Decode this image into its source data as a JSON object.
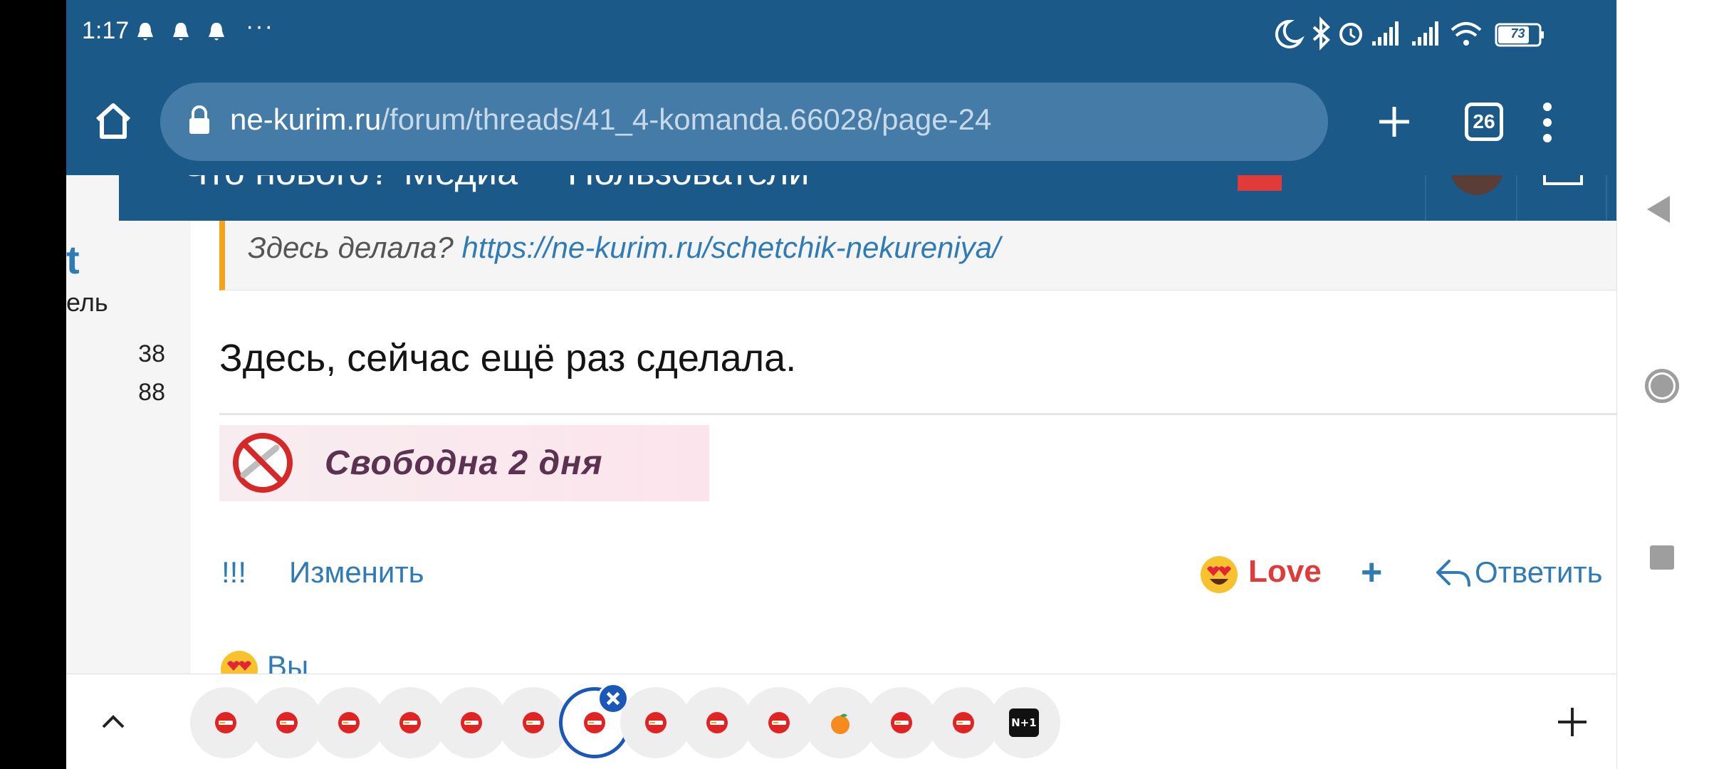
{
  "status_bar": {
    "time": "1:17",
    "more": "···",
    "battery": "73",
    "icons": [
      "bell-icon",
      "bell-icon",
      "bell-icon",
      "moon-icon",
      "bluetooth-icon",
      "alarm-icon",
      "signal-icon",
      "signal-icon",
      "wifi-icon",
      "battery-icon"
    ]
  },
  "browser": {
    "url_domain": "ne-kurim.ru",
    "url_path": "/forum/threads/41_4-komanda.66028/page-24",
    "tab_count": "26"
  },
  "forum_nav": {
    "items": [
      "Что нового?",
      "Медиа",
      "Пользователи"
    ]
  },
  "author": {
    "name_fragment": "t",
    "role_fragment": "ель",
    "stats": [
      "38",
      "88"
    ]
  },
  "post": {
    "quote_prefix": "Здесь делала? ",
    "quote_link": "https://ne-kurim.ru/schetchik-nekureniya/",
    "message": "Здесь, сейчас ещё раз сделала.",
    "banner_text": "Свободна 2 дня",
    "actions": {
      "report": "!!!",
      "edit": "Изменить",
      "reaction": "Love",
      "add": "+",
      "reply": "Ответить"
    },
    "reactors": "Вы"
  },
  "tab_strip": {
    "tabs": [
      {
        "icon": "ne-kurim-favicon",
        "active": false
      },
      {
        "icon": "ne-kurim-favicon",
        "active": false
      },
      {
        "icon": "ne-kurim-favicon",
        "active": false
      },
      {
        "icon": "ne-kurim-favicon",
        "active": false
      },
      {
        "icon": "ne-kurim-favicon",
        "active": false
      },
      {
        "icon": "ne-kurim-favicon",
        "active": false
      },
      {
        "icon": "ne-kurim-favicon",
        "active": true
      },
      {
        "icon": "ne-kurim-favicon",
        "active": false
      },
      {
        "icon": "ne-kurim-favicon",
        "active": false
      },
      {
        "icon": "ne-kurim-favicon",
        "active": false
      },
      {
        "icon": "orange-favicon",
        "active": false
      },
      {
        "icon": "ne-kurim-favicon",
        "active": false
      },
      {
        "icon": "ne-kurim-favicon",
        "active": false
      },
      {
        "icon": "nplus1-favicon",
        "active": false
      }
    ],
    "nplus1_label": "N+1"
  },
  "colors": {
    "brand_blue": "#1b5a88",
    "url_box": "#457ca7",
    "link_blue": "#2f7bb5",
    "love_red": "#e03a3a",
    "quote_border": "#f3a41b",
    "active_tab_blue": "#1b57b8"
  }
}
